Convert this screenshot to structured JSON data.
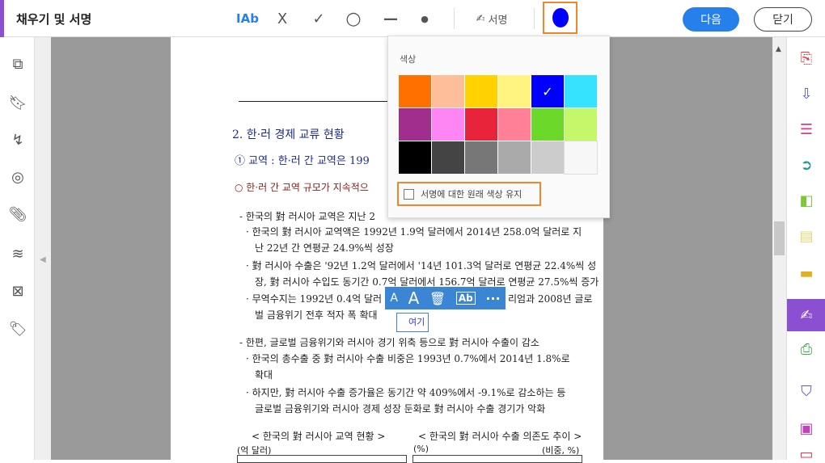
{
  "toolbar": {
    "title": "채우기 및 서명",
    "text_tool": "IAb",
    "cross": "X",
    "check": "✓",
    "circle": "○",
    "line": "—",
    "dot": "●",
    "sign_label": "서명",
    "next_label": "다음",
    "close_label": "닫기",
    "current_color": "#0000ff"
  },
  "color_popup": {
    "label": "색상",
    "swatches": [
      "#ff7000",
      "#ffbe9a",
      "#ffd200",
      "#fff480",
      "#0000ff",
      "#35e3ff",
      "#a02e8c",
      "#fe86f4",
      "#e8243a",
      "#ff8097",
      "#6cd92a",
      "#c4f76a",
      "#000000",
      "#444444",
      "#777777",
      "#aaaaaa",
      "#cccccc",
      "#f7f7f7"
    ],
    "selected_index": 4,
    "keep_original_label": "서명에 대한 원래 색상 유지",
    "keep_original_checked": false
  },
  "float_toolbar": {
    "small_a": "A",
    "large_a": "A",
    "text_field": "Ab",
    "more": "···"
  },
  "field_text": "여기",
  "document": {
    "h2": "2. 한·러 경제 교류 현황",
    "h3": "① 교역 : 한·러 간 교역은 199",
    "h4": "○ 한·러 간 교역 규모가 지속적으",
    "lines": [
      "- 한국의 對 러시아 교역은 지난 2",
      "· 한국의 對 러시아 교역액은 1992년 1.9억 달러에서 2014년 258.0억 달러로 지",
      "난 22년 간 연평균 24.9%씩 성장",
      "· 對 러시아 수출은 '92년 1.2억 달러에서 '14년 101.3억 달러로 연평균 22.4%씩 성",
      "장, 對 러시아 수입도 동기간 0.7억 달러에서 156.7억 달러로 연평균 27.5%씩 증가",
      "· 무역수지는 1992년 0.4억 달러",
      "벌 금융위기 전후 적자 폭 확대",
      "- 한편, 글로벌 금융위기와 러시아 경기 위축 등으로 對 러시아 수출이 감소",
      "· 한국의 총수출 중 對 러시아 수출 비중은 1993년 0.7%에서 2014년 1.8%로",
      "확대",
      "· 하지만, 對 러시아 수출 증가율은 동기간 약 409%에서 -9.1%로 감소하는 등",
      "글로벌 금융위기와 러시아 경제 성장 둔화로 對 러시아 수출 경기가 악화"
    ],
    "line5_tail": "리엄과 2008년 글로",
    "chart1_title": "< 한국의 對 러시아 교역 현황 >",
    "chart1_unit": "(억 달러)",
    "chart2_title": "< 한국의 對 러시아 수출 의존도 추이 >",
    "chart2_unit_left": "(%)",
    "chart2_unit_right": "(비중, %)"
  }
}
